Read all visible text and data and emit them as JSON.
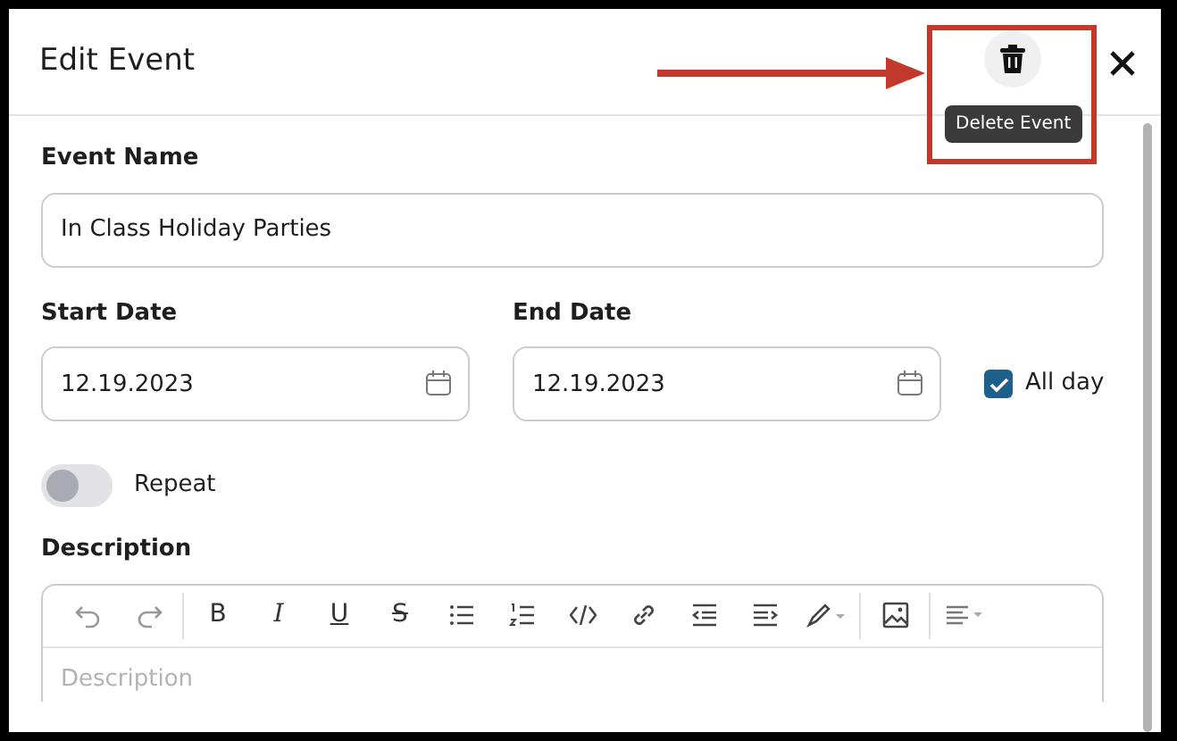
{
  "dialog": {
    "title": "Edit Event",
    "tooltip": "Delete Event"
  },
  "fields": {
    "event_name": {
      "label": "Event Name",
      "value": "In Class Holiday Parties"
    },
    "start_date": {
      "label": "Start Date",
      "value": "12.19.2023"
    },
    "end_date": {
      "label": "End Date",
      "value": "12.19.2023"
    },
    "all_day": {
      "label": "All day",
      "checked": true
    },
    "repeat": {
      "label": "Repeat",
      "on": false
    }
  },
  "description": {
    "label": "Description",
    "format_buttons": [
      "B",
      "I",
      "U",
      "S"
    ],
    "placeholder": "Description"
  }
}
